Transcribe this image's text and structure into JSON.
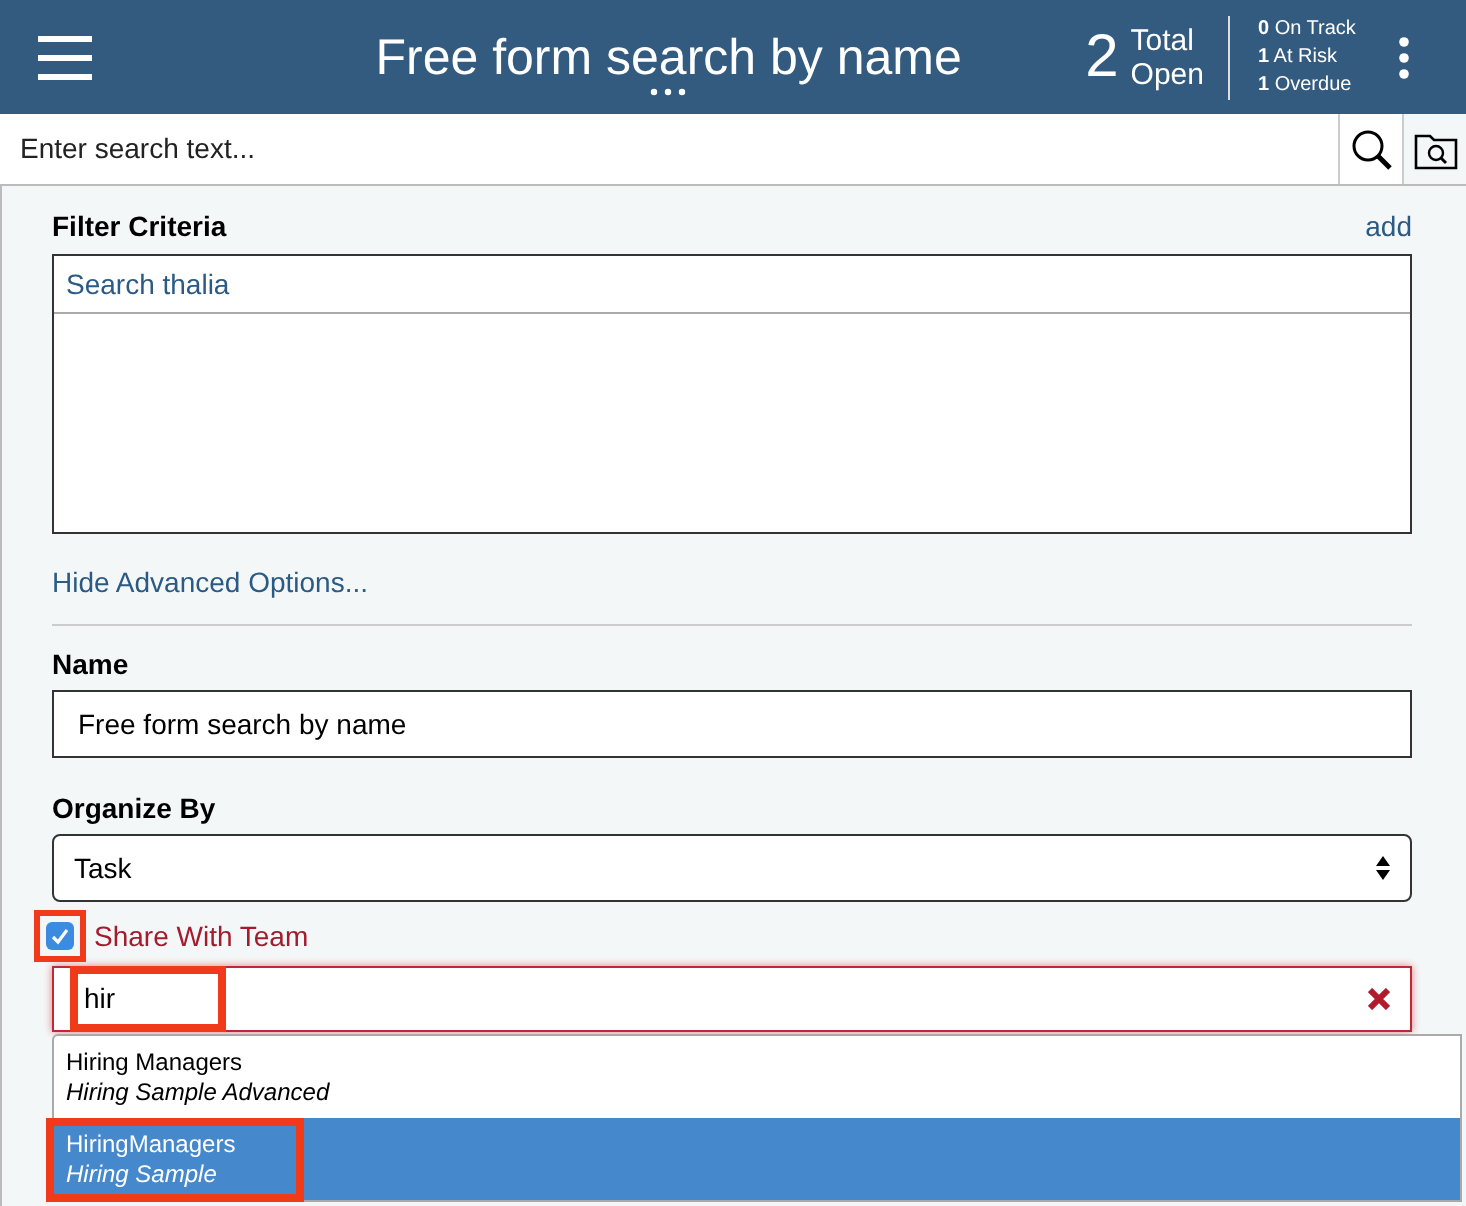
{
  "header": {
    "title": "Free form search by name",
    "total_count": "2",
    "total_label_1": "Total",
    "total_label_2": "Open",
    "stats": [
      {
        "count": "0",
        "label": "On Track"
      },
      {
        "count": "1",
        "label": "At Risk"
      },
      {
        "count": "1",
        "label": "Overdue"
      }
    ]
  },
  "search": {
    "placeholder": "Enter search text..."
  },
  "filter": {
    "label": "Filter Criteria",
    "add_link": "add",
    "items": [
      "Search thalia"
    ]
  },
  "advanced_link": "Hide Advanced Options...",
  "name_field": {
    "label": "Name",
    "value": "Free form search by name"
  },
  "organize": {
    "label": "Organize By",
    "value": "Task"
  },
  "share": {
    "label": "Share With Team",
    "checked": true,
    "highlighted": true
  },
  "team_field": {
    "value": "hir",
    "highlighted": true
  },
  "suggestions": [
    {
      "name": "Hiring Managers",
      "detail": "Hiring Sample Advanced",
      "selected": false,
      "highlighted": false
    },
    {
      "name": "HiringManagers",
      "detail": "Hiring Sample",
      "selected": true,
      "highlighted": true
    }
  ]
}
